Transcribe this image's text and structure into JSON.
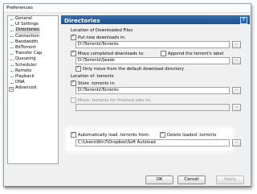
{
  "window": {
    "title": "Preferences"
  },
  "tree": {
    "items": [
      {
        "label": "General"
      },
      {
        "label": "UI Settings"
      },
      {
        "label": "Directories"
      },
      {
        "label": "Connection"
      },
      {
        "label": "Bandwidth"
      },
      {
        "label": "BitTorrent"
      },
      {
        "label": "Transfer Cap"
      },
      {
        "label": "Queueing"
      },
      {
        "label": "Scheduler"
      },
      {
        "label": "Remote"
      },
      {
        "label": "Playback"
      },
      {
        "label": "DNA"
      },
      {
        "label": "Advanced",
        "expander": "+"
      }
    ],
    "selected": "Directories"
  },
  "panel": {
    "title": "Directories",
    "help_glyph": "?",
    "section1": "Location of Downloaded Files",
    "put_new_label": "Put new downloads in:",
    "put_new_value": "D:\\Torrents\\Torrents",
    "move_completed_label": "Move completed downloads to:",
    "append_label": "Append the torrent's label",
    "move_completed_value": "D:\\Torrents\\Seeds",
    "only_move_label": "Only move from the default download directory",
    "section2": "Location of .torrents",
    "store_label": "Store .torrents in:",
    "store_value": "D:\\Torrents\\Torrents",
    "move_finished_label": "Move .torrents for finished jobs to:",
    "move_finished_value": "",
    "auto_load_label": "Automatically load .torrents from:",
    "delete_loaded_label": "Delete loaded .torrents",
    "auto_load_value": "C:\\Users\\Win7\\Dropbox\\Soft Autoload",
    "browse_glyph": "..."
  },
  "buttons": {
    "ok": "OK",
    "cancel": "Cancel",
    "apply": "Apply"
  }
}
